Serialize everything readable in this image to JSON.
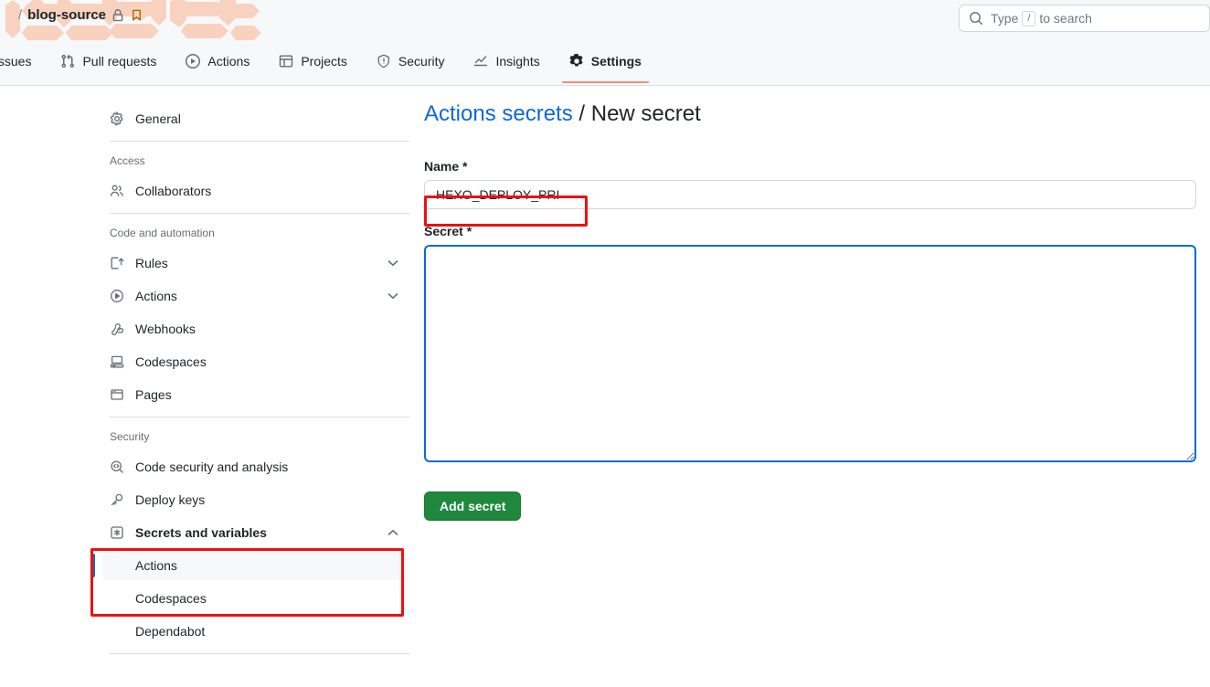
{
  "header": {
    "repo_owner_redacted": true,
    "slash": "/",
    "repo_name": "blog-source",
    "lock_icon": "lock-icon",
    "bookmark_icon": "bookmark-icon",
    "search": {
      "icon": "search-icon",
      "placeholder_prefix": "Type",
      "key": "/",
      "placeholder_suffix": "to search"
    }
  },
  "nav": {
    "items": [
      {
        "label": "Issues",
        "icon": "issue-opened-icon",
        "active": false
      },
      {
        "label": "Pull requests",
        "icon": "git-pull-request-icon",
        "active": false
      },
      {
        "label": "Actions",
        "icon": "play-icon",
        "active": false
      },
      {
        "label": "Projects",
        "icon": "table-icon",
        "active": false
      },
      {
        "label": "Security",
        "icon": "shield-icon",
        "active": false
      },
      {
        "label": "Insights",
        "icon": "graph-icon",
        "active": false
      },
      {
        "label": "Settings",
        "icon": "gear-icon",
        "active": true
      }
    ],
    "active_underline_color": "#fd8c73"
  },
  "sidebar": {
    "general": {
      "label": "General",
      "icon": "gear-icon"
    },
    "sections": [
      {
        "heading": "Access",
        "items": [
          {
            "label": "Collaborators",
            "icon": "people-icon",
            "expandable": false
          }
        ]
      },
      {
        "heading": "Code and automation",
        "items": [
          {
            "label": "Rules",
            "icon": "rules-icon",
            "expandable": true,
            "expanded": false
          },
          {
            "label": "Actions",
            "icon": "play-icon",
            "expandable": true,
            "expanded": false
          },
          {
            "label": "Webhooks",
            "icon": "webhook-icon",
            "expandable": false
          },
          {
            "label": "Codespaces",
            "icon": "codespaces-icon",
            "expandable": false
          },
          {
            "label": "Pages",
            "icon": "browser-icon",
            "expandable": false
          }
        ]
      },
      {
        "heading": "Security",
        "items": [
          {
            "label": "Code security and analysis",
            "icon": "code-search-icon",
            "expandable": false
          },
          {
            "label": "Deploy keys",
            "icon": "key-icon",
            "expandable": false
          },
          {
            "label": "Secrets and variables",
            "icon": "asterisk-icon",
            "expandable": true,
            "expanded": true,
            "bold": true
          }
        ],
        "subitems": [
          {
            "label": "Actions",
            "selected": true
          },
          {
            "label": "Codespaces",
            "selected": false
          },
          {
            "label": "Dependabot",
            "selected": false
          }
        ]
      }
    ]
  },
  "main": {
    "breadcrumb_link": "Actions secrets",
    "breadcrumb_separator": "/",
    "breadcrumb_current": "New secret",
    "name_field": {
      "label": "Name *",
      "value": "HEXO_DEPLOY_PRI",
      "placeholder": ""
    },
    "secret_field": {
      "label": "Secret *",
      "value": "",
      "placeholder": "",
      "focused": true
    },
    "submit_button": "Add secret"
  },
  "annotations": {
    "color": "#ee1111",
    "boxes": [
      {
        "name": "name-input-highlight"
      },
      {
        "name": "secrets-and-variables-highlight"
      }
    ]
  },
  "colors": {
    "accent_blue": "#0969da",
    "green_button": "#1f883d",
    "tab_underline": "#fd8c73",
    "redaction": "#fad0bc",
    "selected_bar": "#0969da"
  }
}
